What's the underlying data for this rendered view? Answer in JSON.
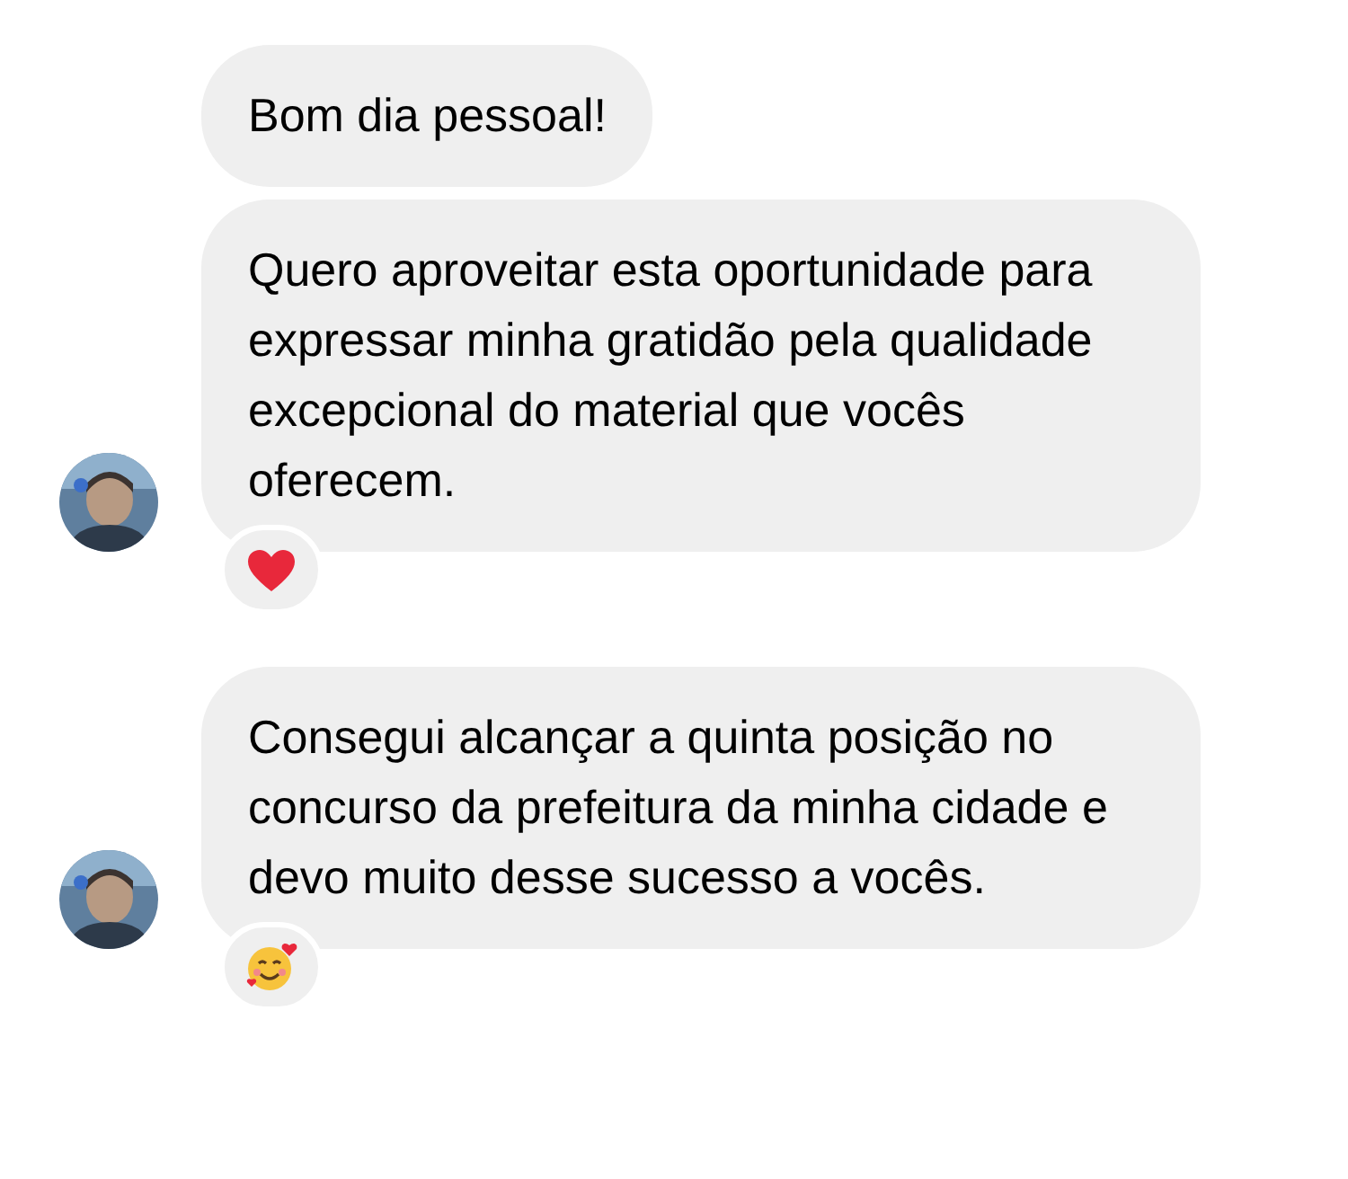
{
  "groups": [
    {
      "messages": [
        "Bom dia pessoal!",
        "Quero aproveitar esta oportunidade para expressar minha gratidão pela qualidade excepcional do material que vocês oferecem."
      ],
      "reaction": {
        "kind": "heart"
      }
    },
    {
      "messages": [
        "Consegui alcançar a quinta posição no concurso da prefeitura da minha cidade e devo muito desse sucesso a vocês."
      ],
      "reaction": {
        "kind": "smiling-hearts"
      }
    }
  ]
}
